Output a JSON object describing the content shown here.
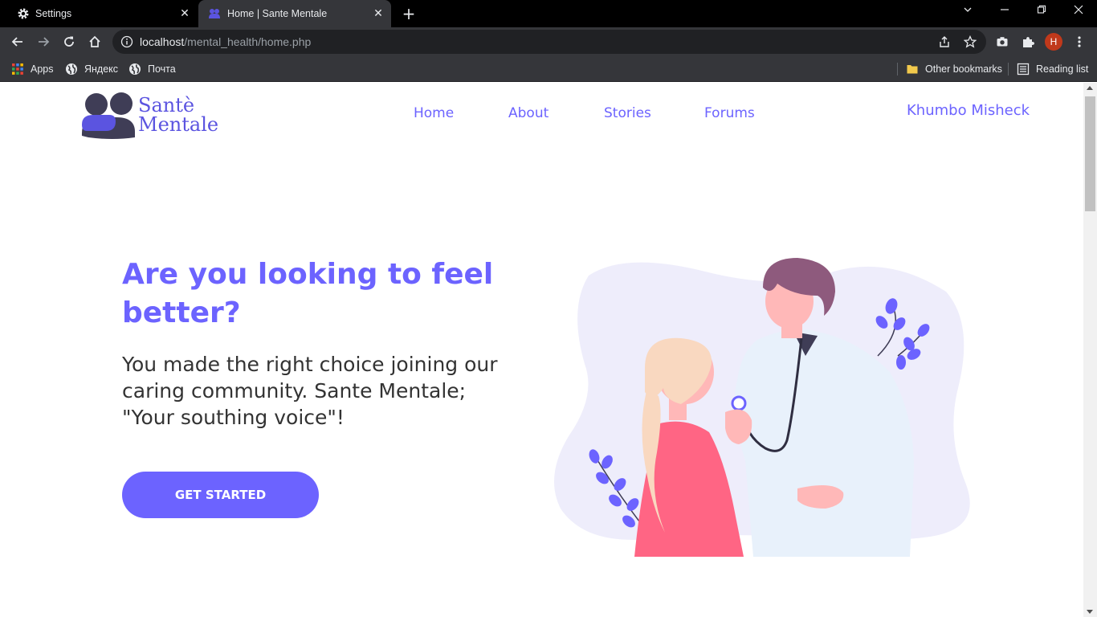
{
  "browser": {
    "tabs": [
      {
        "title": "Settings",
        "icon": "gear-icon",
        "active": false
      },
      {
        "title": "Home | Sante Mentale",
        "icon": "site-logo-icon",
        "active": true
      }
    ],
    "url_host": "localhost",
    "url_path": "/mental_health/home.php",
    "profile_initial": "H",
    "bookmarks": [
      {
        "label": "Apps",
        "icon": "apps-grid-icon"
      },
      {
        "label": "Яндекс",
        "icon": "globe-icon"
      },
      {
        "label": "Почта",
        "icon": "globe-icon"
      }
    ],
    "other_bookmarks": "Other bookmarks",
    "reading_list": "Reading list"
  },
  "site": {
    "logo_line1": "Santè",
    "logo_line2": "Mentale",
    "nav": [
      "Home",
      "About",
      "Stories",
      "Forums"
    ],
    "user_name": "Khumbo Misheck"
  },
  "hero": {
    "title": "Are you looking to feel better?",
    "subtitle": "You made the right choice joining our caring community. Sante Mentale; \"Your southing voice\"!",
    "cta": "GET STARTED"
  },
  "colors": {
    "accent": "#6c63ff",
    "text": "#333333",
    "chrome_dark": "#35363a"
  }
}
